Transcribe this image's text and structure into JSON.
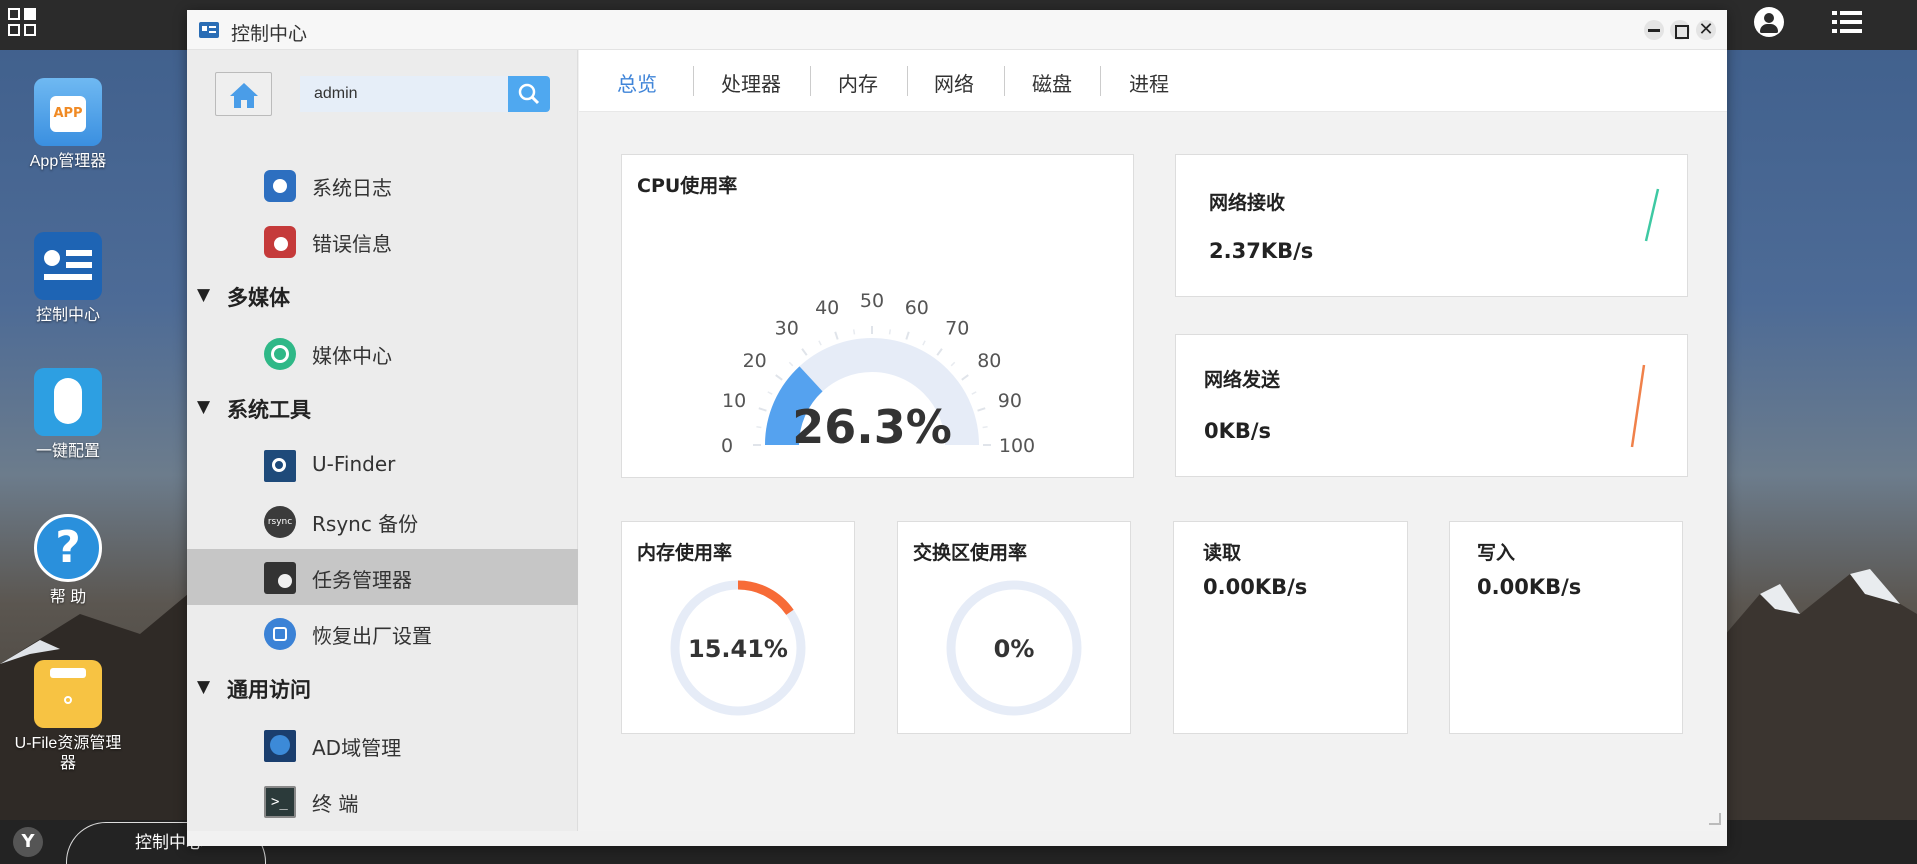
{
  "desktop": {
    "icons": [
      {
        "label": "App管理器",
        "icon": "app-manager-icon"
      },
      {
        "label": "控制中心",
        "icon": "control-center-icon"
      },
      {
        "label": "一键配置",
        "icon": "one-click-config-icon"
      },
      {
        "label": "帮 助",
        "icon": "help-icon"
      },
      {
        "label": "U-File资源管理器",
        "icon": "ufile-manager-icon"
      }
    ],
    "app_badge": "APP"
  },
  "taskbar": {
    "active_tab": "控制中心"
  },
  "window": {
    "title": "控制中心",
    "close_glyph": "✕"
  },
  "sidebar": {
    "search_value": "admin",
    "items": [
      {
        "type": "item",
        "label": "系统日志",
        "icon": "system-log-icon"
      },
      {
        "type": "item",
        "label": "错误信息",
        "icon": "error-info-icon"
      },
      {
        "type": "group",
        "label": "多媒体"
      },
      {
        "type": "item",
        "label": "媒体中心",
        "icon": "media-center-icon"
      },
      {
        "type": "group",
        "label": "系统工具"
      },
      {
        "type": "item",
        "label": "U-Finder",
        "icon": "u-finder-icon"
      },
      {
        "type": "item",
        "label": "Rsync 备份",
        "icon": "rsync-icon"
      },
      {
        "type": "item",
        "label": "任务管理器",
        "icon": "task-manager-icon",
        "active": true
      },
      {
        "type": "item",
        "label": "恢复出厂设置",
        "icon": "factory-reset-icon"
      },
      {
        "type": "group",
        "label": "通用访问"
      },
      {
        "type": "item",
        "label": "AD域管理",
        "icon": "ad-domain-icon"
      },
      {
        "type": "item",
        "label": "终 端",
        "icon": "terminal-icon"
      }
    ],
    "group_arrow": "▼"
  },
  "tabs": [
    "总览",
    "处理器",
    "内存",
    "网络",
    "磁盘",
    "进程"
  ],
  "active_tab": "总览",
  "cpu": {
    "title": "CPU使用率",
    "value": "26.3%",
    "percent": 26.3,
    "ticks": [
      "0",
      "10",
      "20",
      "30",
      "40",
      "50",
      "60",
      "70",
      "80",
      "90",
      "100"
    ]
  },
  "net_recv": {
    "title": "网络接收",
    "value": "2.37KB/s"
  },
  "net_send": {
    "title": "网络发送",
    "value": "0KB/s"
  },
  "memory": {
    "title": "内存使用率",
    "value": "15.41%",
    "percent": 15.41
  },
  "swap": {
    "title": "交换区使用率",
    "value": "0%",
    "percent": 0
  },
  "disk_read": {
    "title": "读取",
    "value": "0.00KB/s"
  },
  "disk_write": {
    "title": "写入",
    "value": "0.00KB/s"
  },
  "colors": {
    "accent": "#3f84d8",
    "gauge_fill": "#55a2ef",
    "track": "#e6ecf7",
    "ring_fill": "#f76b37",
    "recv_line": "#3ec9a3",
    "send_line": "#f0814a"
  }
}
